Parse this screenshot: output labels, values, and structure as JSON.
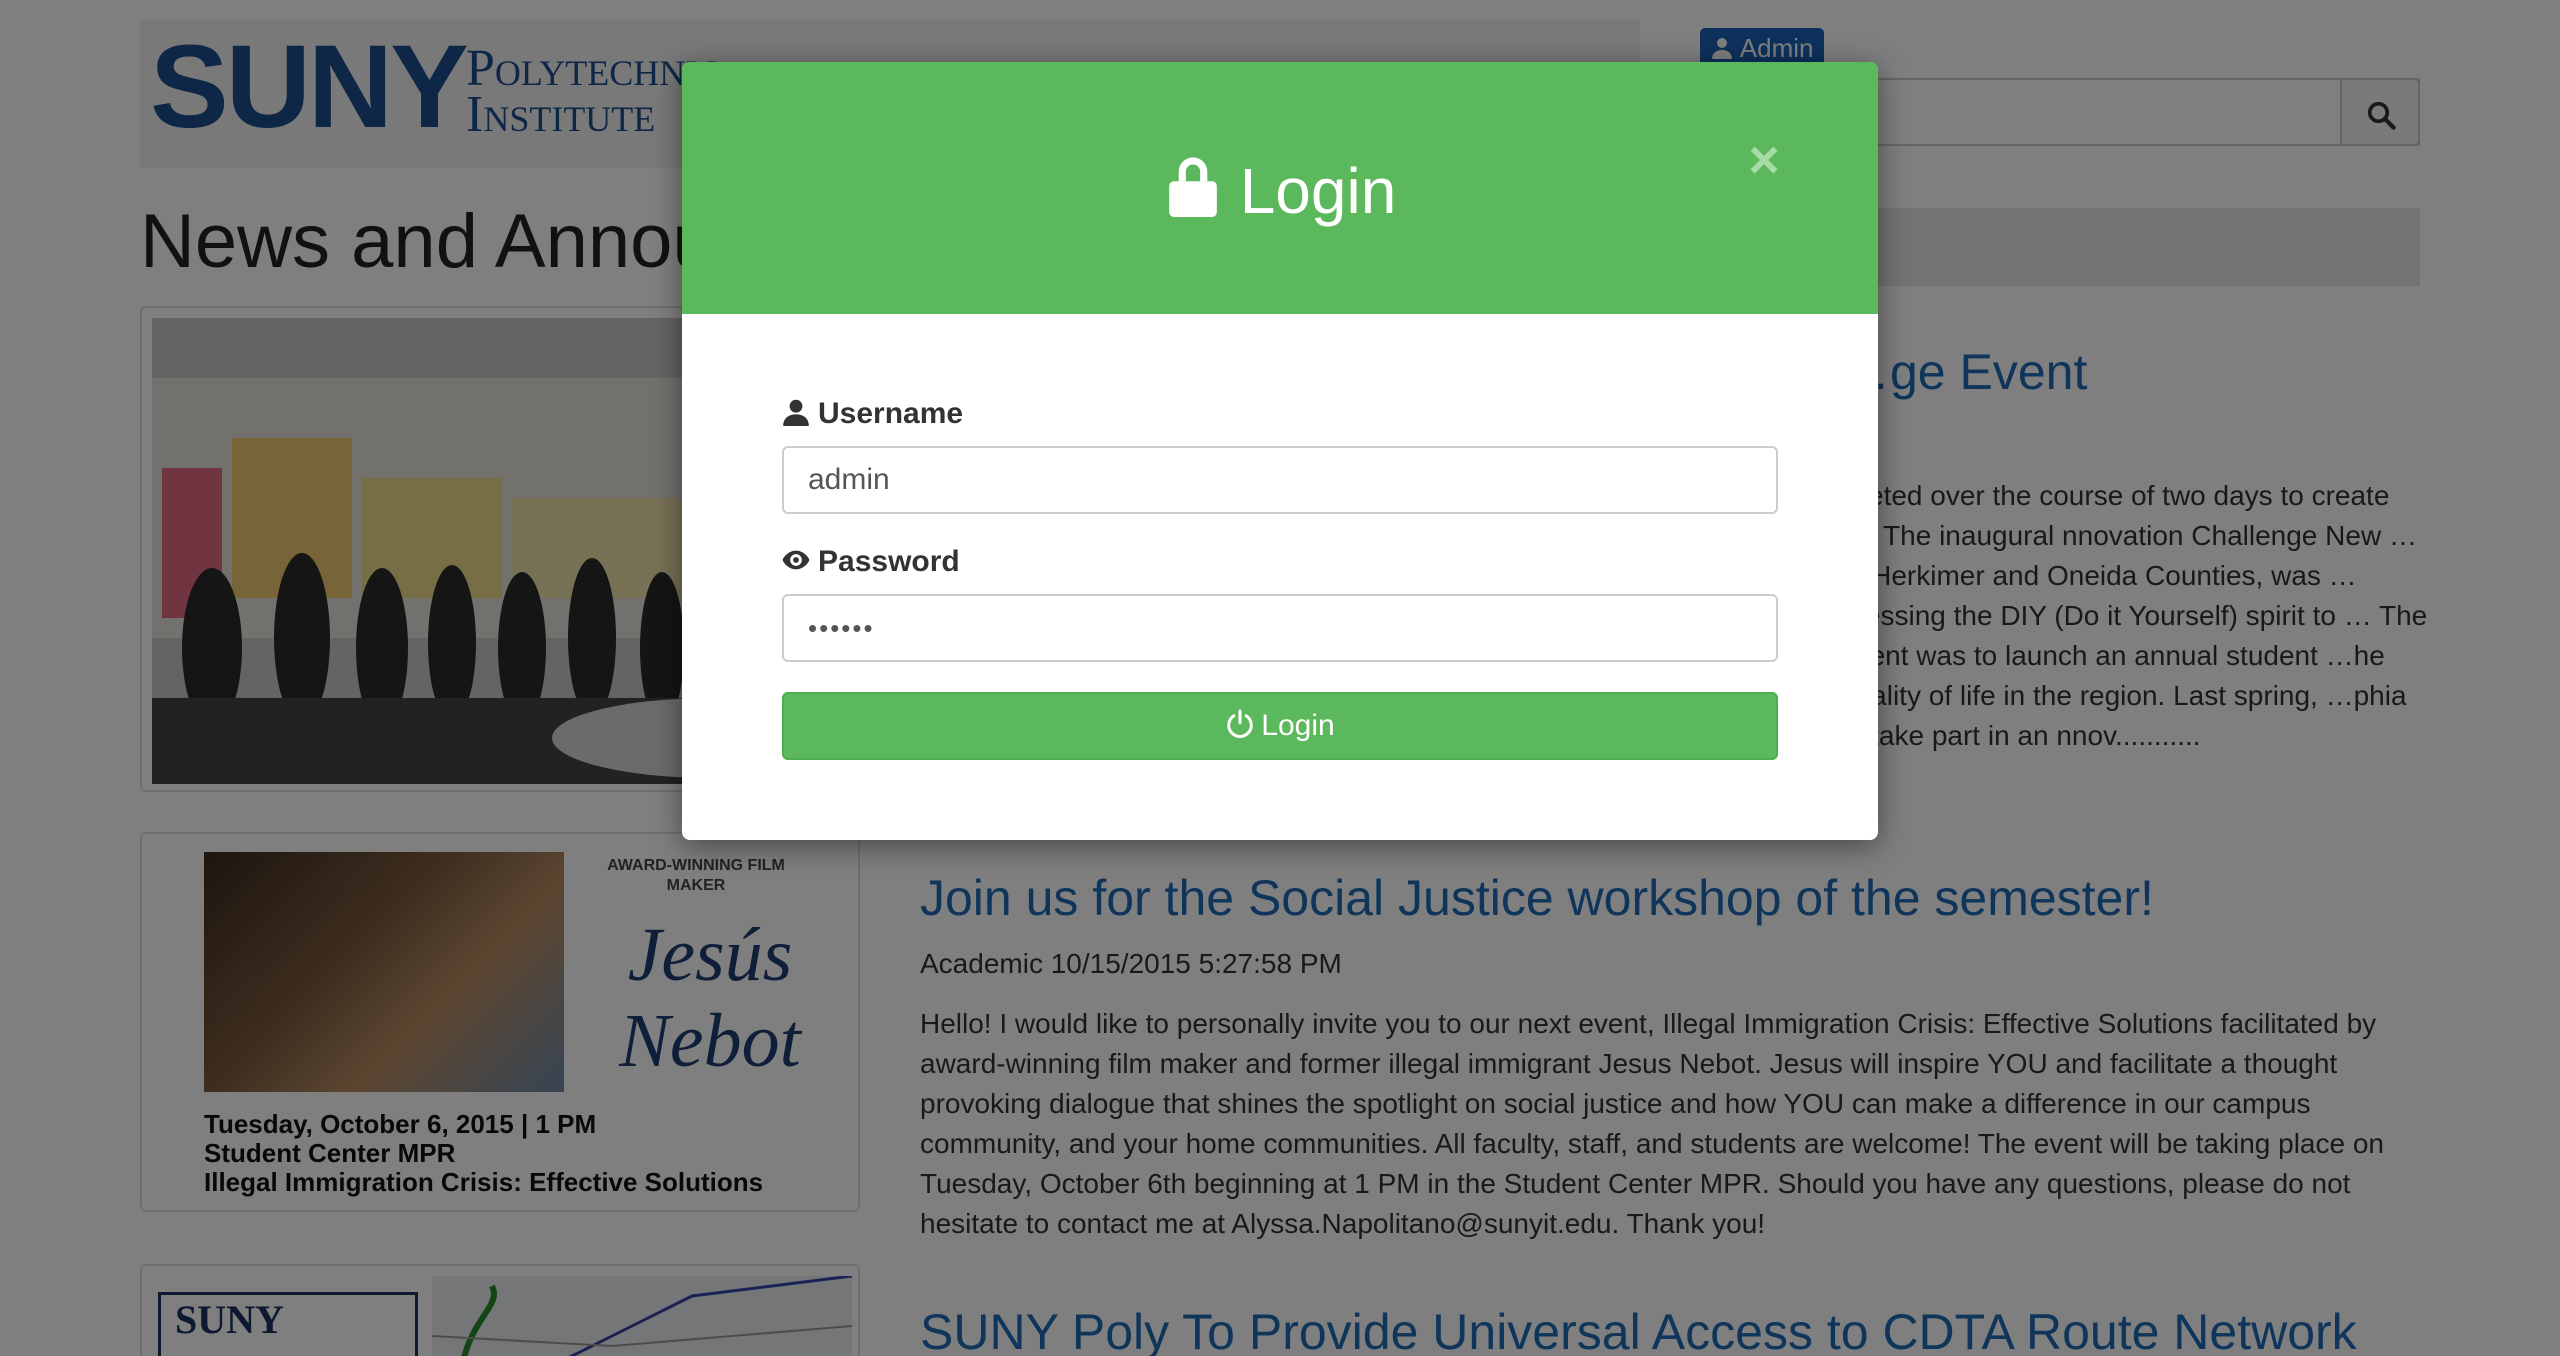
{
  "header": {
    "logo_primary": "SUNY",
    "logo_secondary_line1": "Polytechnic",
    "logo_secondary_line2": "Institute",
    "admin_label": "Admin",
    "search": {
      "placeholder": "",
      "icon": "search-icon"
    }
  },
  "main": {
    "heading": "News and Announcements",
    "articles": [
      {
        "title": "…ge Event",
        "text": "…eted over the course of two days to create …. The inaugural nnovation Challenge New …of Herkimer and Oneida Counties, was …rnessing the DIY (Do it Yourself) spirit to … The intent was to launch an annual student …he quality of life in the region. Last spring, …phia to take part in an nnov..........."
      },
      {
        "title": "Join us for the Social Justice workshop of the semester!",
        "meta": "Academic 10/15/2015 5:27:58 PM",
        "text": "Hello! I would like to personally invite you to our next event, Illegal Immigration Crisis: Effective Solutions facilitated by award-winning film maker and former illegal immigrant Jesus Nebot. Jesus will inspire YOU and facilitate a thought provoking dialogue that shines the spotlight on social justice and how YOU can make a difference in our campus community, and your home communities. All faculty, staff, and students are welcome! The event will be taking place on Tuesday, October 6th beginning at 1 PM in the Student Center MPR. Should you have any questions, please do not hesitate to contact me at Alyssa.Napolitano@sunyit.edu. Thank you!"
      },
      {
        "title": "SUNY Poly To Provide Universal Access to CDTA Route Network"
      }
    ],
    "flyer": {
      "award": "AWARD-WINNING FILM MAKER",
      "name_line1": "Jesús",
      "name_line2": "Nebot",
      "caption_line1": "Tuesday, October 6, 2015 | 1 PM",
      "caption_line2": "Student Center MPR",
      "caption_line3": "Illegal Immigration Crisis: Effective Solutions"
    },
    "map_logo": "SUNY"
  },
  "modal": {
    "title": "Login",
    "close_symbol": "×",
    "username_label": "Username",
    "username_value": "admin",
    "password_label": "Password",
    "password_value": "••••••",
    "submit_label": "Login",
    "colors": {
      "header": "#5cb85c",
      "button": "#5cb85c"
    },
    "icons": [
      "lock-icon",
      "user-icon",
      "eye-icon",
      "power-icon",
      "close-icon"
    ]
  }
}
